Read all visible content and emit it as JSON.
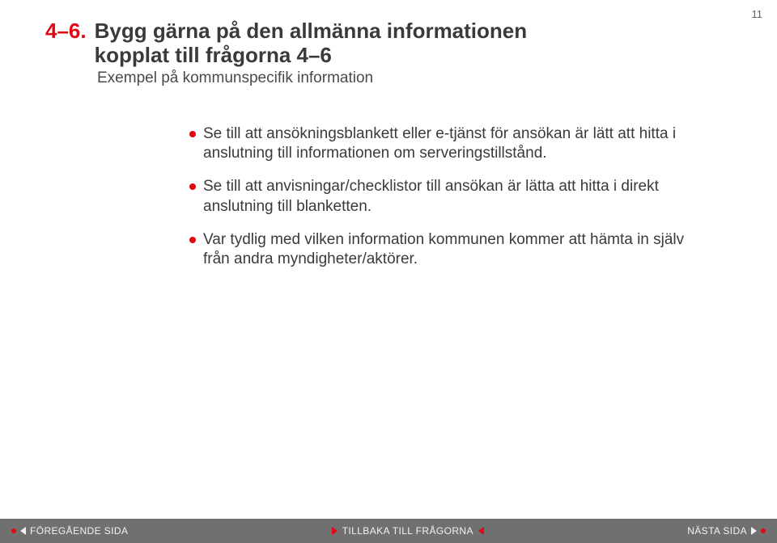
{
  "page_number": "11",
  "heading": {
    "prefix": "4–6.",
    "line1": "Bygg gärna på den allmänna informationen",
    "line2": "kopplat till frågorna 4–6"
  },
  "subtitle": "Exempel på kommunspecifik information",
  "bullets": [
    "Se till att ansökningsblankett eller e-tjänst för ansökan är lätt att hitta i anslutning till informationen om serveringstillstånd.",
    "Se till att anvisningar/checklistor till ansökan är lätta att hitta i direkt anslutning till blanketten.",
    "Var tydlig med vilken information kommunen kommer att hämta in själv från andra myndigheter/aktörer."
  ],
  "footer": {
    "prev": "FÖREGÅENDE SIDA",
    "back": "TILLBAKA TILL FRÅGORNA",
    "next": "NÄSTA SIDA"
  }
}
